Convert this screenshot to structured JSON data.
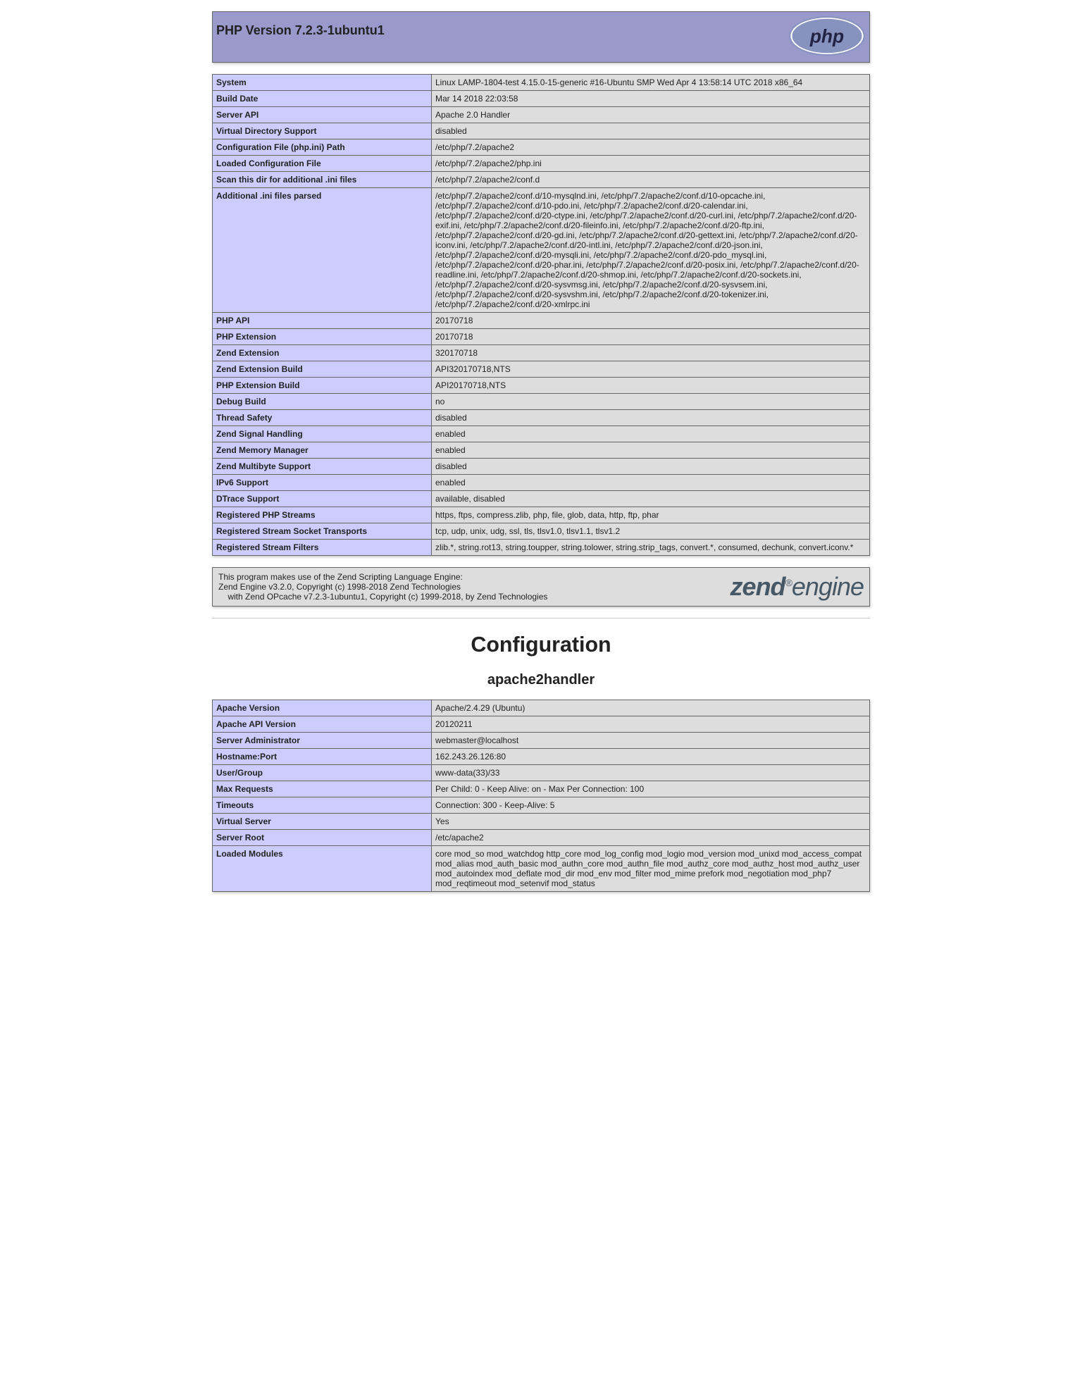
{
  "header": {
    "title": "PHP Version 7.2.3-1ubuntu1"
  },
  "info": {
    "rows": [
      {
        "label": "System",
        "value": "Linux LAMP-1804-test 4.15.0-15-generic #16-Ubuntu SMP Wed Apr 4 13:58:14 UTC 2018 x86_64"
      },
      {
        "label": "Build Date",
        "value": "Mar 14 2018 22:03:58"
      },
      {
        "label": "Server API",
        "value": "Apache 2.0 Handler"
      },
      {
        "label": "Virtual Directory Support",
        "value": "disabled"
      },
      {
        "label": "Configuration File (php.ini) Path",
        "value": "/etc/php/7.2/apache2"
      },
      {
        "label": "Loaded Configuration File",
        "value": "/etc/php/7.2/apache2/php.ini"
      },
      {
        "label": "Scan this dir for additional .ini files",
        "value": "/etc/php/7.2/apache2/conf.d"
      },
      {
        "label": "Additional .ini files parsed",
        "value": "/etc/php/7.2/apache2/conf.d/10-mysqlnd.ini, /etc/php/7.2/apache2/conf.d/10-opcache.ini, /etc/php/7.2/apache2/conf.d/10-pdo.ini, /etc/php/7.2/apache2/conf.d/20-calendar.ini, /etc/php/7.2/apache2/conf.d/20-ctype.ini, /etc/php/7.2/apache2/conf.d/20-curl.ini, /etc/php/7.2/apache2/conf.d/20-exif.ini, /etc/php/7.2/apache2/conf.d/20-fileinfo.ini, /etc/php/7.2/apache2/conf.d/20-ftp.ini, /etc/php/7.2/apache2/conf.d/20-gd.ini, /etc/php/7.2/apache2/conf.d/20-gettext.ini, /etc/php/7.2/apache2/conf.d/20-iconv.ini, /etc/php/7.2/apache2/conf.d/20-intl.ini, /etc/php/7.2/apache2/conf.d/20-json.ini, /etc/php/7.2/apache2/conf.d/20-mysqli.ini, /etc/php/7.2/apache2/conf.d/20-pdo_mysql.ini, /etc/php/7.2/apache2/conf.d/20-phar.ini, /etc/php/7.2/apache2/conf.d/20-posix.ini, /etc/php/7.2/apache2/conf.d/20-readline.ini, /etc/php/7.2/apache2/conf.d/20-shmop.ini, /etc/php/7.2/apache2/conf.d/20-sockets.ini, /etc/php/7.2/apache2/conf.d/20-sysvmsg.ini, /etc/php/7.2/apache2/conf.d/20-sysvsem.ini, /etc/php/7.2/apache2/conf.d/20-sysvshm.ini, /etc/php/7.2/apache2/conf.d/20-tokenizer.ini, /etc/php/7.2/apache2/conf.d/20-xmlrpc.ini"
      },
      {
        "label": "PHP API",
        "value": "20170718"
      },
      {
        "label": "PHP Extension",
        "value": "20170718"
      },
      {
        "label": "Zend Extension",
        "value": "320170718"
      },
      {
        "label": "Zend Extension Build",
        "value": "API320170718,NTS"
      },
      {
        "label": "PHP Extension Build",
        "value": "API20170718,NTS"
      },
      {
        "label": "Debug Build",
        "value": "no"
      },
      {
        "label": "Thread Safety",
        "value": "disabled"
      },
      {
        "label": "Zend Signal Handling",
        "value": "enabled"
      },
      {
        "label": "Zend Memory Manager",
        "value": "enabled"
      },
      {
        "label": "Zend Multibyte Support",
        "value": "disabled"
      },
      {
        "label": "IPv6 Support",
        "value": "enabled"
      },
      {
        "label": "DTrace Support",
        "value": "available, disabled"
      },
      {
        "label": "Registered PHP Streams",
        "value": "https, ftps, compress.zlib, php, file, glob, data, http, ftp, phar"
      },
      {
        "label": "Registered Stream Socket Transports",
        "value": "tcp, udp, unix, udg, ssl, tls, tlsv1.0, tlsv1.1, tlsv1.2"
      },
      {
        "label": "Registered Stream Filters",
        "value": "zlib.*, string.rot13, string.toupper, string.tolower, string.strip_tags, convert.*, consumed, dechunk, convert.iconv.*"
      }
    ]
  },
  "zend": {
    "line1": "This program makes use of the Zend Scripting Language Engine:",
    "line2": "Zend Engine v3.2.0, Copyright (c) 1998-2018 Zend Technologies",
    "line3": "    with Zend OPcache v7.2.3-1ubuntu1, Copyright (c) 1999-2018, by Zend Technologies"
  },
  "configuration": {
    "heading": "Configuration",
    "module_heading": "apache2handler",
    "rows": [
      {
        "label": "Apache Version",
        "value": "Apache/2.4.29 (Ubuntu)"
      },
      {
        "label": "Apache API Version",
        "value": "20120211"
      },
      {
        "label": "Server Administrator",
        "value": "webmaster@localhost"
      },
      {
        "label": "Hostname:Port",
        "value": "162.243.26.126:80"
      },
      {
        "label": "User/Group",
        "value": "www-data(33)/33"
      },
      {
        "label": "Max Requests",
        "value": "Per Child: 0 - Keep Alive: on - Max Per Connection: 100"
      },
      {
        "label": "Timeouts",
        "value": "Connection: 300 - Keep-Alive: 5"
      },
      {
        "label": "Virtual Server",
        "value": "Yes"
      },
      {
        "label": "Server Root",
        "value": "/etc/apache2"
      },
      {
        "label": "Loaded Modules",
        "value": "core mod_so mod_watchdog http_core mod_log_config mod_logio mod_version mod_unixd mod_access_compat mod_alias mod_auth_basic mod_authn_core mod_authn_file mod_authz_core mod_authz_host mod_authz_user mod_autoindex mod_deflate mod_dir mod_env mod_filter mod_mime prefork mod_negotiation mod_php7 mod_reqtimeout mod_setenvif mod_status"
      }
    ]
  }
}
